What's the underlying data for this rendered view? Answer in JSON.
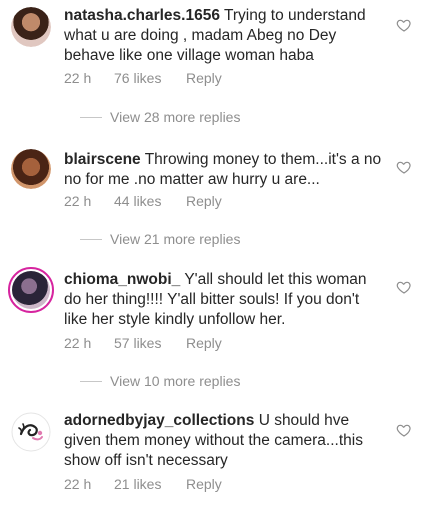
{
  "comments": [
    {
      "username": "natasha.charles.1656",
      "text": "Trying to understand what u are doing , madam Abeg no Dey behave like one village woman haba",
      "time": "22 h",
      "likes": "76 likes",
      "reply": "Reply",
      "view_replies": "View 28 more replies"
    },
    {
      "username": "blairscene",
      "text": "Throwing money to them...it's a no no for me .no matter aw hurry u are...",
      "time": "22 h",
      "likes": "44 likes",
      "reply": "Reply",
      "view_replies": "View 21 more replies"
    },
    {
      "username": "chioma_nwobi_",
      "text": "Y'all should let this woman do her thing!!!! Y'all bitter souls! If you don't like her style kindly unfollow her.",
      "time": "22 h",
      "likes": "57 likes",
      "reply": "Reply",
      "view_replies": "View 10 more replies"
    },
    {
      "username": "adornedbyjay_collections",
      "text": "U should hve given them money without the camera...this show off isn't necessary",
      "time": "22 h",
      "likes": "21 likes",
      "reply": "Reply"
    }
  ]
}
